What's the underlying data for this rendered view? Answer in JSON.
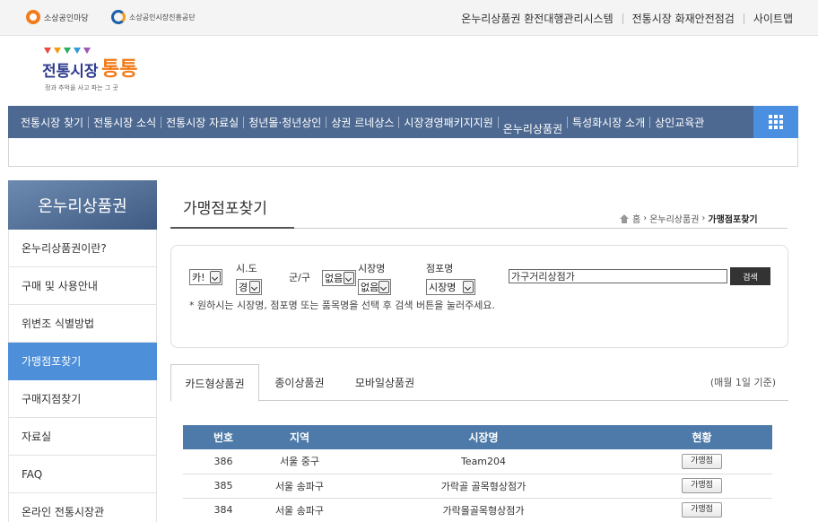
{
  "topbar": {
    "brand1": "소상공인마당",
    "brand2": "소상공인시장진흥공단",
    "links": [
      "온누리상품권 환전대행관리시스템",
      "전통시장 화재안전점검",
      "사이트맵"
    ]
  },
  "logo": {
    "name1": "전통시장",
    "name2": "통통",
    "tagline": "정과 추억을 사고 파는 그 곳"
  },
  "gnb": {
    "items": [
      "전통시장 찾기",
      "전통시장 소식",
      "전통시장 자료실",
      "청년몰·청년상인",
      "상권 르네상스",
      "시장경영패키지지원",
      "온누리상품권",
      "특성화시장 소개",
      "상인교육관"
    ]
  },
  "sidebar": {
    "title": "온누리상품권",
    "items": [
      "온누리상품권이란?",
      "구매 및 사용안내",
      "위변조 식별방법",
      "가맹점포찾기",
      "구매지점찾기",
      "자료실",
      "FAQ",
      "온라인 전통시장관"
    ]
  },
  "page": {
    "title": "가맹점포찾기",
    "breadcrumb": [
      "홈",
      "온누리상품권",
      "가맹점포찾기"
    ]
  },
  "search": {
    "type_value": "카!",
    "sido_label": "시.도",
    "sido_value": "경",
    "gugun_label": "군/구",
    "gugun_value": "없음",
    "market_label": "시장명",
    "market_value": "없음",
    "store_label": "점포명",
    "store_value": "시장명",
    "query_value": "가구거리상점가",
    "button": "검색",
    "note": "* 원하시는 시장명, 점포명 또는 품목명을 선택 후 검색 버튼을 눌러주세요."
  },
  "tabs": {
    "items": [
      "카드형상품권",
      "종이상품권",
      "모바일상품권"
    ],
    "note": "(매월 1일 기준)"
  },
  "table": {
    "headers": [
      "번호",
      "지역",
      "시장명",
      "현황"
    ],
    "rows": [
      {
        "no": "386",
        "region": "서울 중구",
        "market": "Team204",
        "status": "가맹점"
      },
      {
        "no": "385",
        "region": "서울 송파구",
        "market": "가락골 골목형상점가",
        "status": "가맹점"
      },
      {
        "no": "384",
        "region": "서울 송파구",
        "market": "가락몰골목형상점가",
        "status": "가맹점"
      }
    ]
  }
}
